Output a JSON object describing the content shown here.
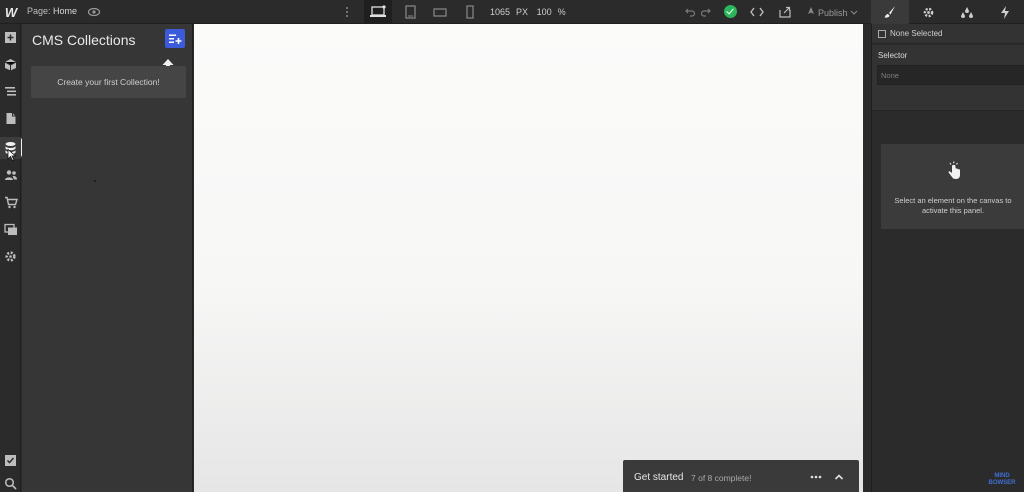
{
  "topbar": {
    "logo": "W",
    "page_prefix": "Page:",
    "page_name": "Home",
    "width_value": "1065",
    "width_unit": "PX",
    "zoom_value": "100",
    "zoom_unit": "%",
    "publish_label": "Publish"
  },
  "right_tabs": [
    "paintbrush-icon",
    "gear-icon",
    "drops-icon",
    "bolt-icon"
  ],
  "cms": {
    "title": "CMS Collections",
    "create_prompt": "Create your first Collection!"
  },
  "get_started": {
    "title": "Get started",
    "progress": "7 of 8 complete!"
  },
  "style_panel": {
    "none_selected": "None Selected",
    "selector_label": "Selector",
    "selector_placeholder": "None",
    "empty_message": "Select an element on the canvas to activate this panel."
  },
  "watermark": {
    "line1": "MIND",
    "line2": "BOWSER"
  },
  "colors": {
    "accent": "#3b5bdb",
    "status_ok": "#2ab55a",
    "canvas": "#fbfbfa"
  }
}
